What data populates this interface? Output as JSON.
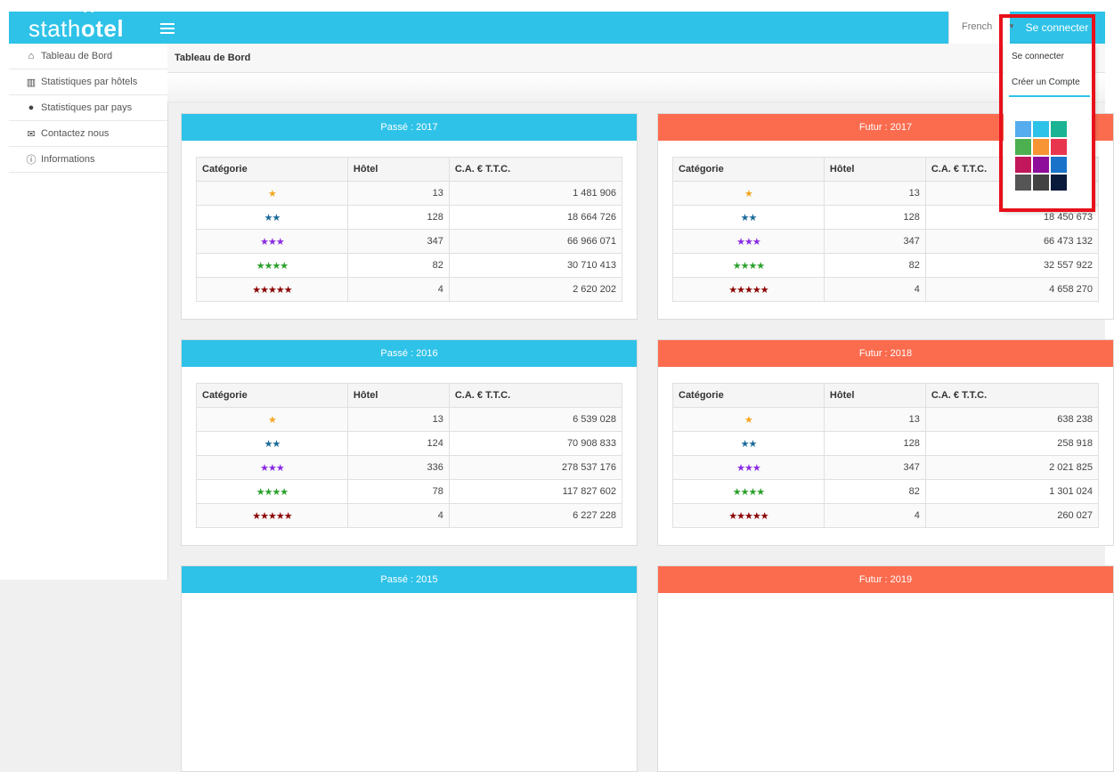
{
  "brand": {
    "prefix": "stath",
    "o": "o",
    "suffix": "tel"
  },
  "topbar": {
    "language": "French",
    "connect_label": "Se connecter"
  },
  "sidebar": {
    "items": [
      {
        "icon": "home-icon",
        "label": "Tableau de Bord"
      },
      {
        "icon": "bar-chart-icon",
        "label": "Statistiques par hôtels"
      },
      {
        "icon": "user-icon",
        "label": "Statistiques par pays"
      },
      {
        "icon": "envelope-icon",
        "label": "Contactez nous"
      },
      {
        "icon": "info-icon",
        "label": "Informations"
      }
    ]
  },
  "breadcrumb": "Tableau de Bord",
  "dropdown": {
    "items": [
      "Se connecter",
      "Créer un Compte"
    ],
    "swatches": [
      "#55acee",
      "#2ec2e8",
      "#1ab394",
      "#4caf50",
      "#f79433",
      "#e8364f",
      "#c2185b",
      "#8e0d9a",
      "#1a73c8",
      "#555555",
      "#424242",
      "#0a1a3a"
    ]
  },
  "columns": [
    "Catégorie",
    "Hôtel",
    "C.A. € T.T.C."
  ],
  "star_colors": [
    "#f5a623",
    "#1a6b9a",
    "#8a2be2",
    "#2aa12a",
    "#8b0000"
  ],
  "panels": [
    {
      "title": "Passé : 2017",
      "kind": "past",
      "rows": [
        [
          "★",
          "13",
          "1 481 906"
        ],
        [
          "★★",
          "128",
          "18 664 726"
        ],
        [
          "★★★",
          "347",
          "66 966 071"
        ],
        [
          "★★★★",
          "82",
          "30 710 413"
        ],
        [
          "★★★★★",
          "4",
          "2 620 202"
        ]
      ]
    },
    {
      "title": "Futur : 2017",
      "kind": "future",
      "rows": [
        [
          "★",
          "13",
          ""
        ],
        [
          "★★",
          "128",
          "18 450 673"
        ],
        [
          "★★★",
          "347",
          "66 473 132"
        ],
        [
          "★★★★",
          "82",
          "32 557 922"
        ],
        [
          "★★★★★",
          "4",
          "4 658 270"
        ]
      ]
    },
    {
      "title": "Passé : 2016",
      "kind": "past",
      "rows": [
        [
          "★",
          "13",
          "6 539 028"
        ],
        [
          "★★",
          "124",
          "70 908 833"
        ],
        [
          "★★★",
          "336",
          "278 537 176"
        ],
        [
          "★★★★",
          "78",
          "117 827 602"
        ],
        [
          "★★★★★",
          "4",
          "6 227 228"
        ]
      ]
    },
    {
      "title": "Futur : 2018",
      "kind": "future",
      "rows": [
        [
          "★",
          "13",
          "638 238"
        ],
        [
          "★★",
          "128",
          "258 918"
        ],
        [
          "★★★",
          "347",
          "2 021 825"
        ],
        [
          "★★★★",
          "82",
          "1 301 024"
        ],
        [
          "★★★★★",
          "4",
          "260 027"
        ]
      ]
    },
    {
      "title": "Passé : 2015",
      "kind": "past",
      "rows": []
    },
    {
      "title": "Futur : 2019",
      "kind": "future",
      "rows": []
    }
  ]
}
